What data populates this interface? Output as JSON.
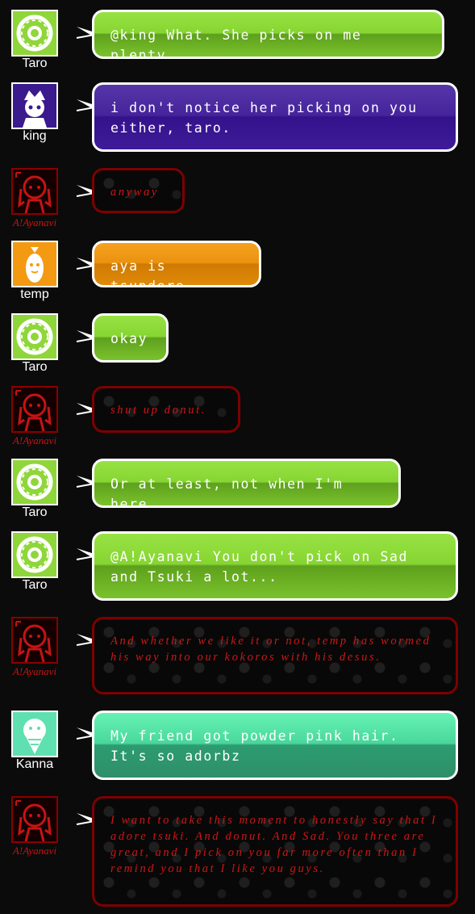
{
  "colors": {
    "background": "#0b0b0b",
    "taro_bubble": "#86d532",
    "king_bubble": "#3b1896",
    "temp_bubble": "#eb920f",
    "kanna_bubble": "#45cf97",
    "ayanavi_text": "#d01616",
    "ayanavi_border": "#7e0000"
  },
  "users": {
    "taro": {
      "name": "Taro",
      "icon": "donut-icon",
      "style": "green"
    },
    "king": {
      "name": "king",
      "icon": "king-avatar-icon",
      "style": "purple"
    },
    "ayanavi": {
      "name": "A!Ayanavi",
      "icon": "red-character-icon",
      "style": "aya"
    },
    "temp": {
      "name": "temp",
      "icon": "fried-shrimp-icon",
      "style": "orange"
    },
    "kanna": {
      "name": "Kanna",
      "icon": "ice-cream-cone-icon",
      "style": "teal"
    }
  },
  "messages": [
    {
      "user": "taro",
      "text": "@king What. She picks on me plenty"
    },
    {
      "user": "king",
      "text": "i don't notice her picking on you either, taro."
    },
    {
      "user": "ayanavi",
      "text": "anyway"
    },
    {
      "user": "temp",
      "text": "aya is tsundere"
    },
    {
      "user": "taro",
      "text": "okay"
    },
    {
      "user": "ayanavi",
      "text": "shut up donut."
    },
    {
      "user": "taro",
      "text": "Or at least, not when I'm here."
    },
    {
      "user": "taro",
      "text": "@A!Ayanavi You don't pick on Sad and Tsuki a lot..."
    },
    {
      "user": "ayanavi",
      "text": "And whether we like it or not, temp has wormed his way into our kokoros with his desus."
    },
    {
      "user": "kanna",
      "text": "My friend got powder pink hair. It's so adorbz"
    },
    {
      "user": "ayanavi",
      "text": "I want to take this moment to honestly say that I adore tsuki. And donut. And Sad. You three are great, and I pick on you far more often than I remind you that I like you guys."
    }
  ]
}
